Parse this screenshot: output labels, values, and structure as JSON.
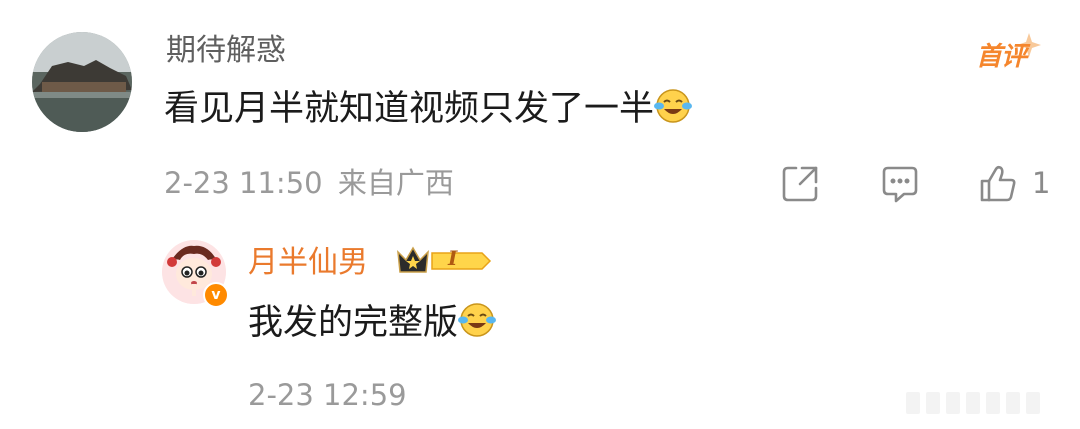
{
  "comment": {
    "username": "期待解惑",
    "badge": "首评",
    "text": "看见月半就知道视频只发了一半",
    "emoji_icon": "laughing-crying-emoji-icon",
    "timestamp": "2-23 11:50",
    "location": "来自广西",
    "like_count": "1"
  },
  "reply": {
    "username": "月半仙男",
    "fan_level": "I",
    "text": "我发的完整版",
    "emoji_icon": "laughing-crying-emoji-icon",
    "timestamp": "2-23 12:59"
  },
  "colors": {
    "accent": "#f5862d",
    "reply_user": "#ea7a2d",
    "meta": "#9a9a9a",
    "text": "#1b1b1b"
  }
}
